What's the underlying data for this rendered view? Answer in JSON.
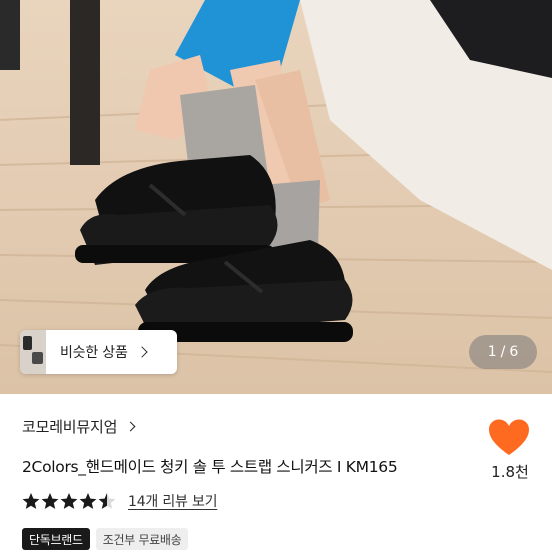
{
  "gallery": {
    "similar_label": "비슷한 상품",
    "counter_current": "1",
    "counter_separator": "/",
    "counter_total": "6"
  },
  "product": {
    "store_name": "코모레비뮤지엄",
    "title": "2Colors_핸드메이드 청키 솔 투 스트랩 스니커즈 I KM165",
    "like_count": "1.8천",
    "rating_stars": 4.5,
    "review_link": "14개 리뷰 보기",
    "badges": [
      "단독브랜드",
      "조건부 무료배송"
    ]
  },
  "colors": {
    "heart": "#ff6a21",
    "star": "#1a1a1a"
  },
  "icons": {
    "like": "heart-icon",
    "store": "chevron-right-icon",
    "similar": "chevron-right-icon",
    "rating": "star-icon"
  }
}
